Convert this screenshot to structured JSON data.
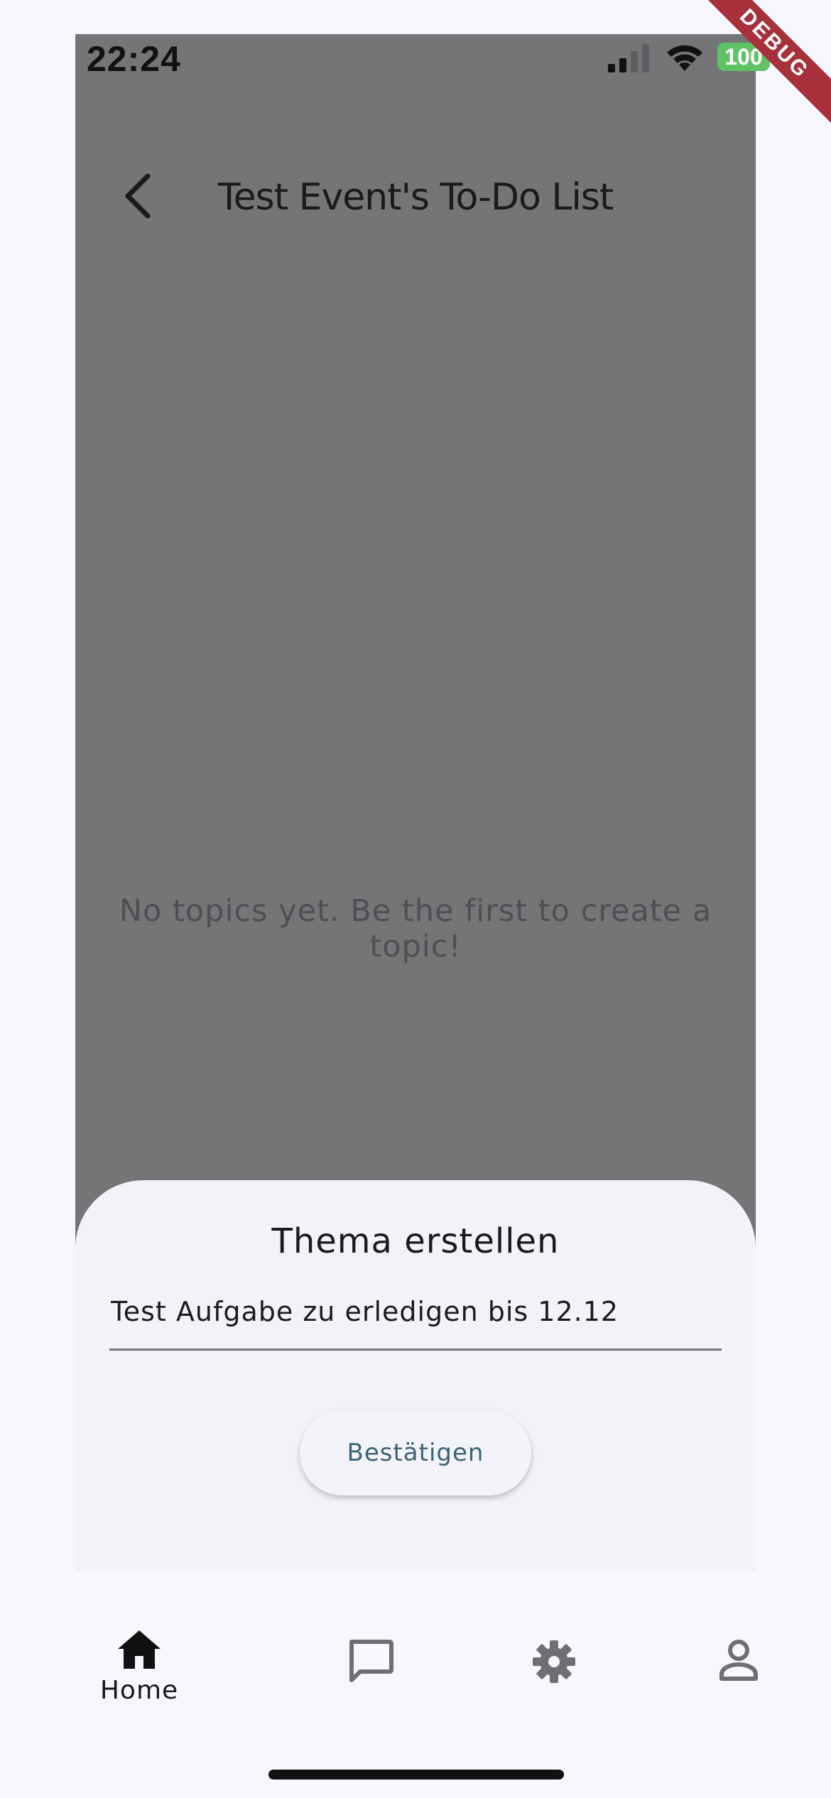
{
  "status_bar": {
    "time": "22:24",
    "battery": "100",
    "debug_label": "DEBUG"
  },
  "app_bar": {
    "title": "Test Event's To-Do List",
    "back_icon": "chevron-left-icon"
  },
  "content": {
    "empty_message": "No topics yet. Be the first to create a topic!"
  },
  "sheet": {
    "title": "Thema erstellen",
    "input_value": "Test Aufgabe zu erledigen bis 12.12",
    "confirm_label": "Bestätigen"
  },
  "bottom_nav": {
    "items": [
      {
        "label": "Home",
        "icon": "home-icon",
        "active": true
      },
      {
        "label": "",
        "icon": "chat-icon",
        "active": false
      },
      {
        "label": "",
        "icon": "gear-icon",
        "active": false
      },
      {
        "label": "",
        "icon": "person-icon",
        "active": false
      }
    ]
  },
  "colors": {
    "overlay": "#747577",
    "sheet_bg": "#f1f3f9",
    "accent": "#3b6276",
    "battery": "#5fc265",
    "debug": "#a8303a"
  }
}
